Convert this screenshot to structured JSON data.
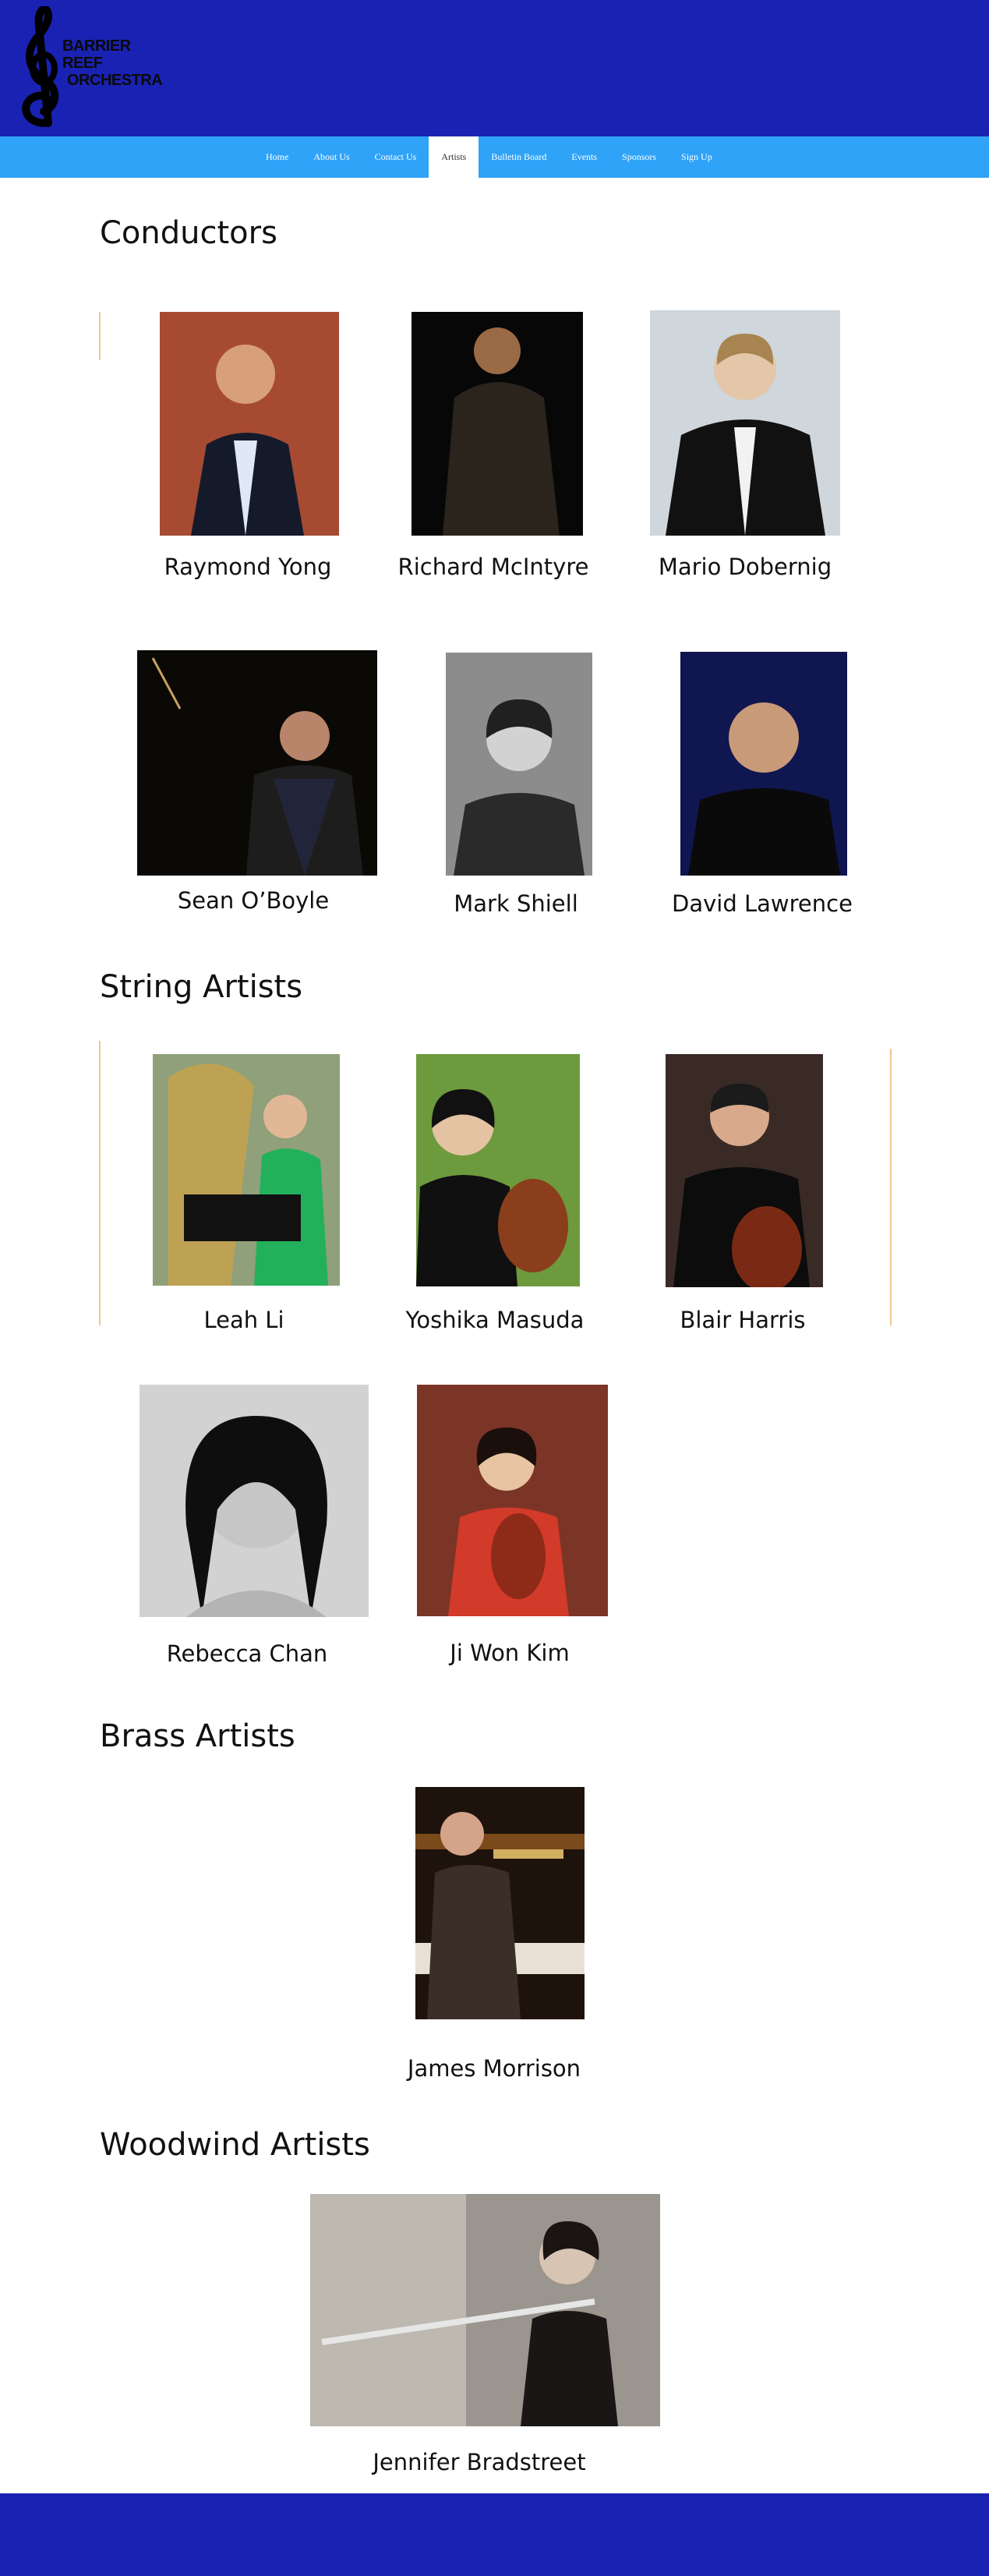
{
  "brand": {
    "logo_line1": "BARRIER REEF",
    "logo_line2": "ORCHESTRA",
    "header_color": "#1a22b3",
    "nav_color": "#2ea3f8"
  },
  "nav": {
    "items": [
      "Home",
      "About Us",
      "Contact Us",
      "Artists",
      "Bulletin Board",
      "Events",
      "Sponsors",
      "Sign Up"
    ],
    "active": "Artists"
  },
  "sections": {
    "conductors": {
      "title": "Conductors",
      "artists": [
        "Raymond Yong",
        "Richard McIntyre",
        "Mario Dobernig",
        "Sean O’Boyle",
        "Mark Shiell",
        "David Lawrence"
      ]
    },
    "strings": {
      "title": "String Artists",
      "artists": [
        "Leah Li",
        "Yoshika Masuda",
        "Blair Harris",
        "Rebecca Chan",
        "Ji Won Kim"
      ]
    },
    "brass": {
      "title": "Brass Artists",
      "artists": [
        "James Morrison"
      ]
    },
    "woodwind": {
      "title": "Woodwind Artists",
      "artists": [
        "Jennifer Bradstreet"
      ]
    }
  }
}
